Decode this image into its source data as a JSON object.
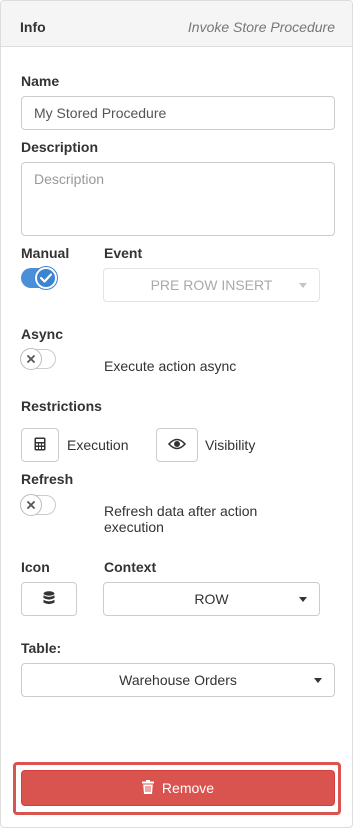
{
  "header": {
    "title": "Info",
    "subtitle": "Invoke Store Procedure"
  },
  "name": {
    "label": "Name",
    "value": "My Stored Procedure"
  },
  "description": {
    "label": "Description",
    "placeholder": "Description",
    "value": ""
  },
  "manual": {
    "label": "Manual",
    "enabled": true
  },
  "event": {
    "label": "Event",
    "value": "PRE ROW INSERT",
    "disabled": true
  },
  "async": {
    "label": "Async",
    "enabled": false,
    "text": "Execute action async"
  },
  "restrictions": {
    "label": "Restrictions",
    "execution": {
      "label": "Execution",
      "icon": "calculator-icon"
    },
    "visibility": {
      "label": "Visibility",
      "icon": "eye-icon"
    }
  },
  "refresh": {
    "label": "Refresh",
    "enabled": false,
    "text_line1": "Refresh data after action",
    "text_line2": "execution"
  },
  "icon_field": {
    "label": "Icon",
    "icon": "database-icon"
  },
  "context": {
    "label": "Context",
    "value": "ROW"
  },
  "table": {
    "label": "Table:",
    "value": "Warehouse Orders"
  },
  "remove": {
    "label": "Remove",
    "icon": "trash-icon"
  },
  "colors": {
    "accent": "#3c83d2",
    "danger": "#d9534f"
  }
}
